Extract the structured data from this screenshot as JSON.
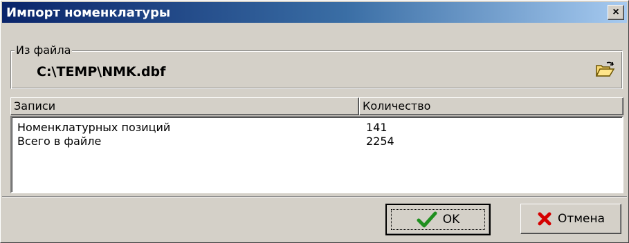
{
  "window": {
    "title": "Импорт номенклатуры",
    "close_glyph": "×"
  },
  "source": {
    "legend": "Из файла",
    "path": "C:\\TEMP\\NMK.dbf",
    "browse_icon": "folder-open-icon"
  },
  "grid": {
    "columns": [
      "Записи",
      "Количество"
    ],
    "rows": [
      {
        "record": "Номенклатурных позиций",
        "count": "141"
      },
      {
        "record": "Всего в файле",
        "count": "2254"
      }
    ]
  },
  "buttons": {
    "ok_label": "OK",
    "cancel_label": "Отмена",
    "ok_icon": "checkmark-icon",
    "cancel_icon": "cross-icon"
  },
  "colors": {
    "title_gradient_start": "#0a246a",
    "title_gradient_end": "#a6caf0",
    "face": "#d4d0c8",
    "ok_check": "#1f8f1f",
    "cancel_cross": "#d40000"
  }
}
